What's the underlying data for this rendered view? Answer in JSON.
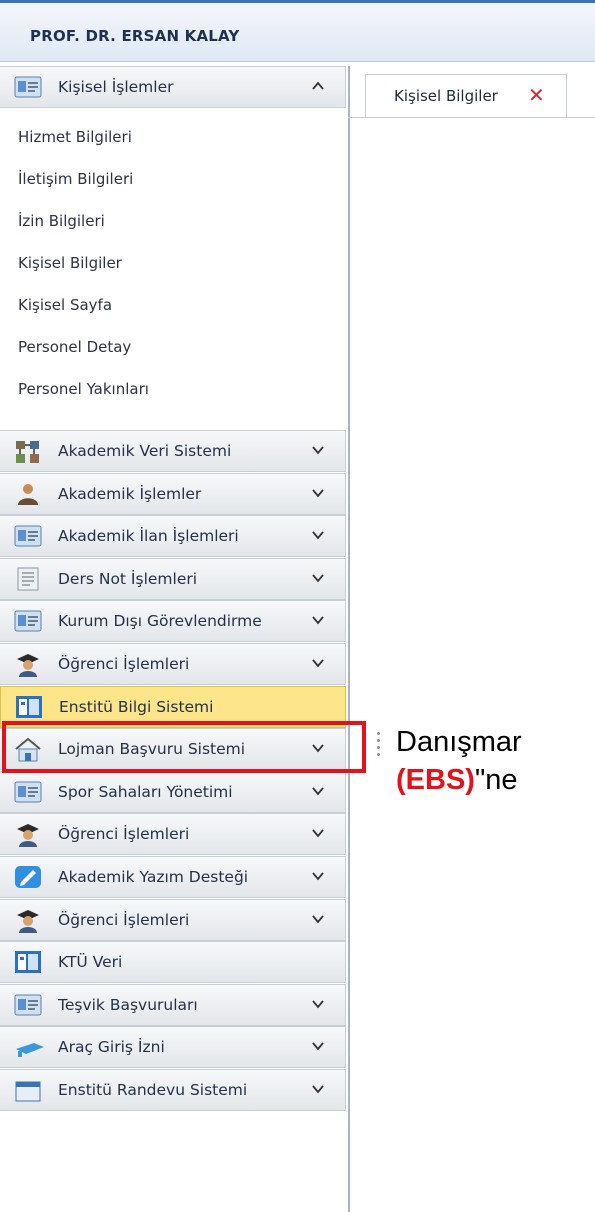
{
  "header": {
    "user_name": "PROF. DR. ERSAN KALAY"
  },
  "tab": {
    "label": "Kişisel Bilgiler",
    "close_symbol": "✕"
  },
  "sidebar": {
    "expanded_group": {
      "label": "Kişisel İşlemler",
      "icon": "id-card-icon",
      "items": [
        "Hizmet Bilgileri",
        "İletişim Bilgileri",
        "İzin Bilgileri",
        "Kişisel Bilgiler",
        "Kişisel Sayfa",
        "Personel Detay",
        "Personel Yakınları"
      ]
    },
    "groups": [
      {
        "label": "Akademik Veri Sistemi",
        "icon": "network-icon",
        "chevron": true
      },
      {
        "label": "Akademik İşlemler",
        "icon": "person-icon",
        "chevron": true
      },
      {
        "label": "Akademik İlan İşlemleri",
        "icon": "id-card-icon",
        "chevron": true
      },
      {
        "label": "Ders Not İşlemleri",
        "icon": "document-icon",
        "chevron": true
      },
      {
        "label": "Kurum Dışı Görevlendirme",
        "icon": "id-card-icon",
        "chevron": true
      },
      {
        "label": "Öğrenci İşlemleri",
        "icon": "graduate-icon",
        "chevron": true
      },
      {
        "label": "Enstitü Bilgi Sistemi",
        "icon": "window-icon",
        "chevron": false,
        "active": true
      },
      {
        "label": "Lojman Başvuru Sistemi",
        "icon": "house-icon",
        "chevron": true
      },
      {
        "label": "Spor Sahaları Yönetimi",
        "icon": "id-card-icon",
        "chevron": true
      },
      {
        "label": "Öğrenci İşlemleri",
        "icon": "graduate-icon",
        "chevron": true
      },
      {
        "label": "Akademik Yazım Desteği",
        "icon": "pen-icon",
        "chevron": true
      },
      {
        "label": "Öğrenci İşlemleri",
        "icon": "graduate-icon",
        "chevron": true
      },
      {
        "label": "KTÜ Veri",
        "icon": "window-icon",
        "chevron": false
      },
      {
        "label": "Teşvik Başvuruları",
        "icon": "id-card-icon",
        "chevron": true
      },
      {
        "label": "Araç Giriş İzni",
        "icon": "camera-icon",
        "chevron": true
      },
      {
        "label": "Enstitü Randevu Sistemi",
        "icon": "calendar-icon",
        "chevron": true
      }
    ]
  },
  "annotation": {
    "line1": "Danışmar",
    "line2_red": "(EBS)",
    "line2_rest": "\"ne"
  },
  "colors": {
    "highlight": "#e3121b",
    "active_row": "#fde58a",
    "top_accent": "#3b74b5"
  }
}
